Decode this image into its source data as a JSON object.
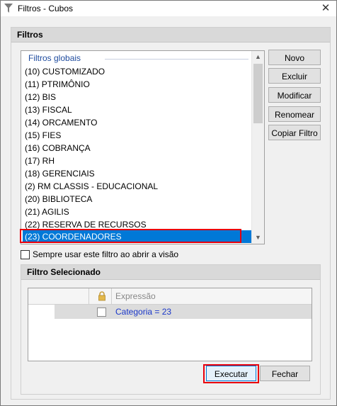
{
  "window": {
    "title": "Filtros - Cubos",
    "close_glyph": "✕",
    "icon": "funnel-icon"
  },
  "filters_group": {
    "header": "Filtros"
  },
  "filter_list": {
    "group_label": "Filtros globais",
    "items": [
      "(10) CUSTOMIZADO",
      "(11) PTRIMÔNIO",
      "(12) BIS",
      "(13) FISCAL",
      "(14) ORCAMENTO",
      "(15) FIES",
      "(16) COBRANÇA",
      "(17) RH",
      "(18) GERENCIAIS",
      "(2) RM CLASSIS - EDUCACIONAL",
      "(20) BIBLIOTECA",
      "(21) AGILIS",
      "(22) RESERVA DE RECURSOS",
      "(23) COORDENADORES"
    ],
    "selected": "(23) COORDENADORES"
  },
  "side_buttons": {
    "novo": "Novo",
    "excluir": "Excluir",
    "modificar": "Modificar",
    "renomear": "Renomear",
    "copiar": "Copiar Filtro"
  },
  "always_use": {
    "label": "Sempre usar este filtro ao abrir a visão",
    "checked": false
  },
  "selected_group": {
    "header": "Filtro Selecionado",
    "column_header": "Expressão",
    "rows": [
      {
        "expression": "Categoria = 23",
        "checked": false
      }
    ]
  },
  "footer": {
    "execute": "Executar",
    "close": "Fechar"
  }
}
